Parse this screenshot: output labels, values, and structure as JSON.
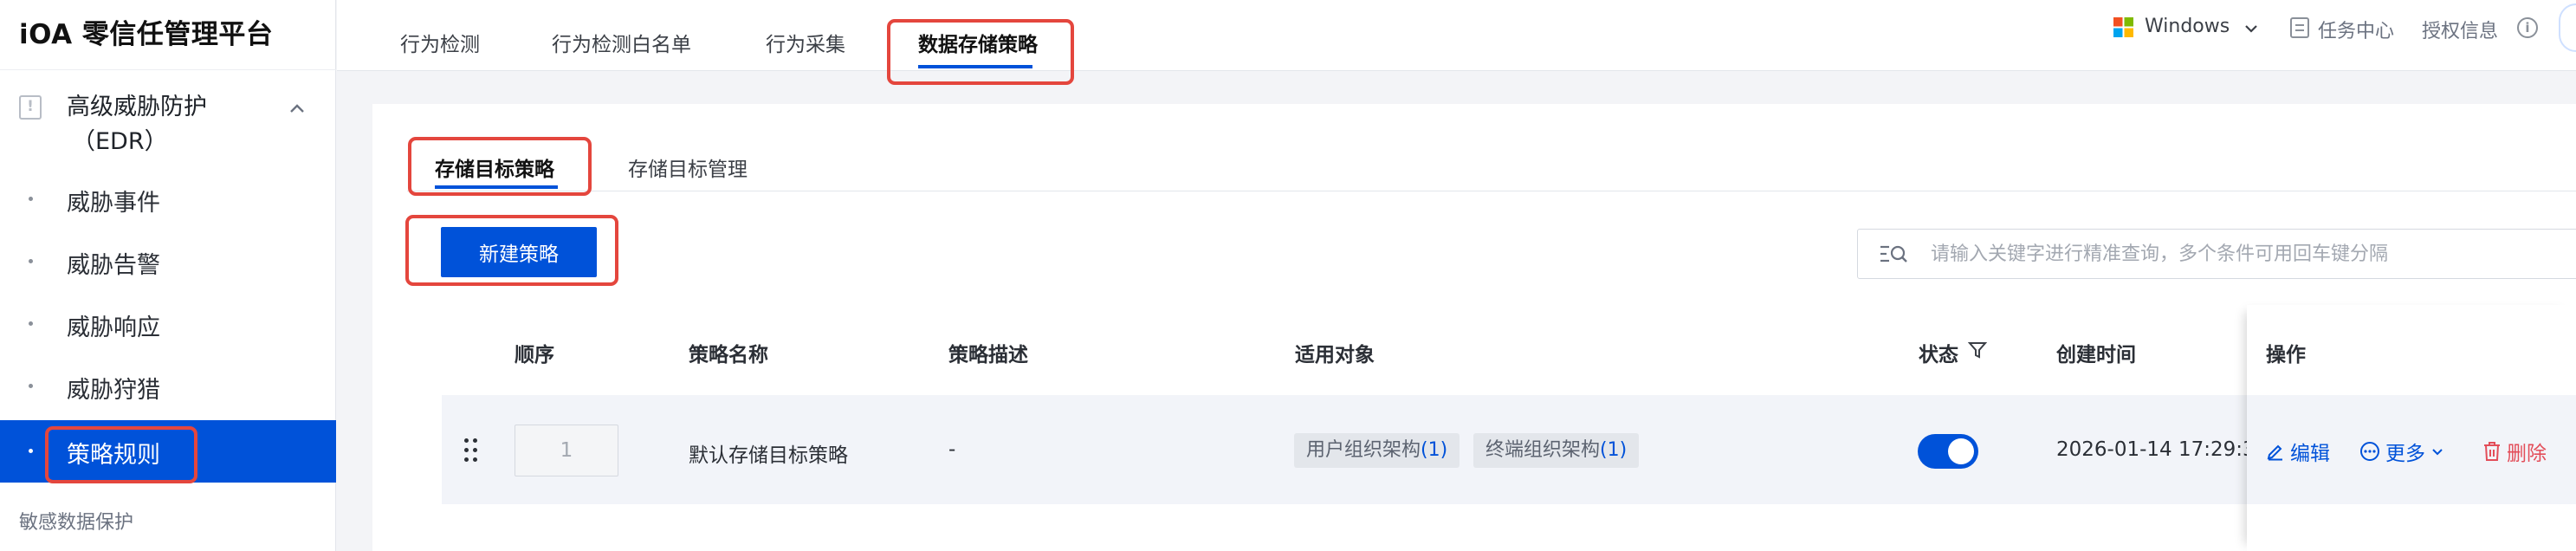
{
  "app": {
    "title": "iOA 零信任管理平台"
  },
  "sidebar": {
    "group": {
      "title_line1": "高级威胁防护",
      "title_line2": "（EDR）"
    },
    "items": [
      {
        "label": "威胁事件"
      },
      {
        "label": "威胁告警"
      },
      {
        "label": "威胁响应"
      },
      {
        "label": "威胁狩猎"
      },
      {
        "label": "策略规则",
        "active": true
      }
    ],
    "next_section": "敏感数据保护"
  },
  "top_tabs": [
    {
      "label": "行为检测"
    },
    {
      "label": "行为检测白名单"
    },
    {
      "label": "行为采集"
    },
    {
      "label": "数据存储策略",
      "active": true
    }
  ],
  "header_tools": {
    "os": "Windows",
    "task_center": "任务中心",
    "license_info": "授权信息"
  },
  "sub_tabs": [
    {
      "label": "存储目标策略",
      "active": true
    },
    {
      "label": "存储目标管理"
    }
  ],
  "toolbar": {
    "new_button": "新建策略"
  },
  "search": {
    "placeholder": "请输入关键字进行精准查询，多个条件可用回车键分隔",
    "value": ""
  },
  "table": {
    "columns": {
      "order": "顺序",
      "name": "策略名称",
      "desc": "策略描述",
      "target": "适用对象",
      "status": "状态",
      "created": "创建时间",
      "actions": "操作"
    },
    "rows": [
      {
        "order": "1",
        "name": "默认存储目标策略",
        "desc": "-",
        "targets": [
          {
            "label": "用户组织架构",
            "count": "(1)"
          },
          {
            "label": "终端组织架构",
            "count": "(1)"
          }
        ],
        "status_enabled": true,
        "created": "2026-01-14 17:29:3",
        "actions": {
          "edit": "编辑",
          "more": "更多",
          "delete": "删除"
        }
      }
    ]
  },
  "colors": {
    "primary": "#0052d9",
    "highlight": "#e4463d",
    "danger": "#e34d59"
  }
}
